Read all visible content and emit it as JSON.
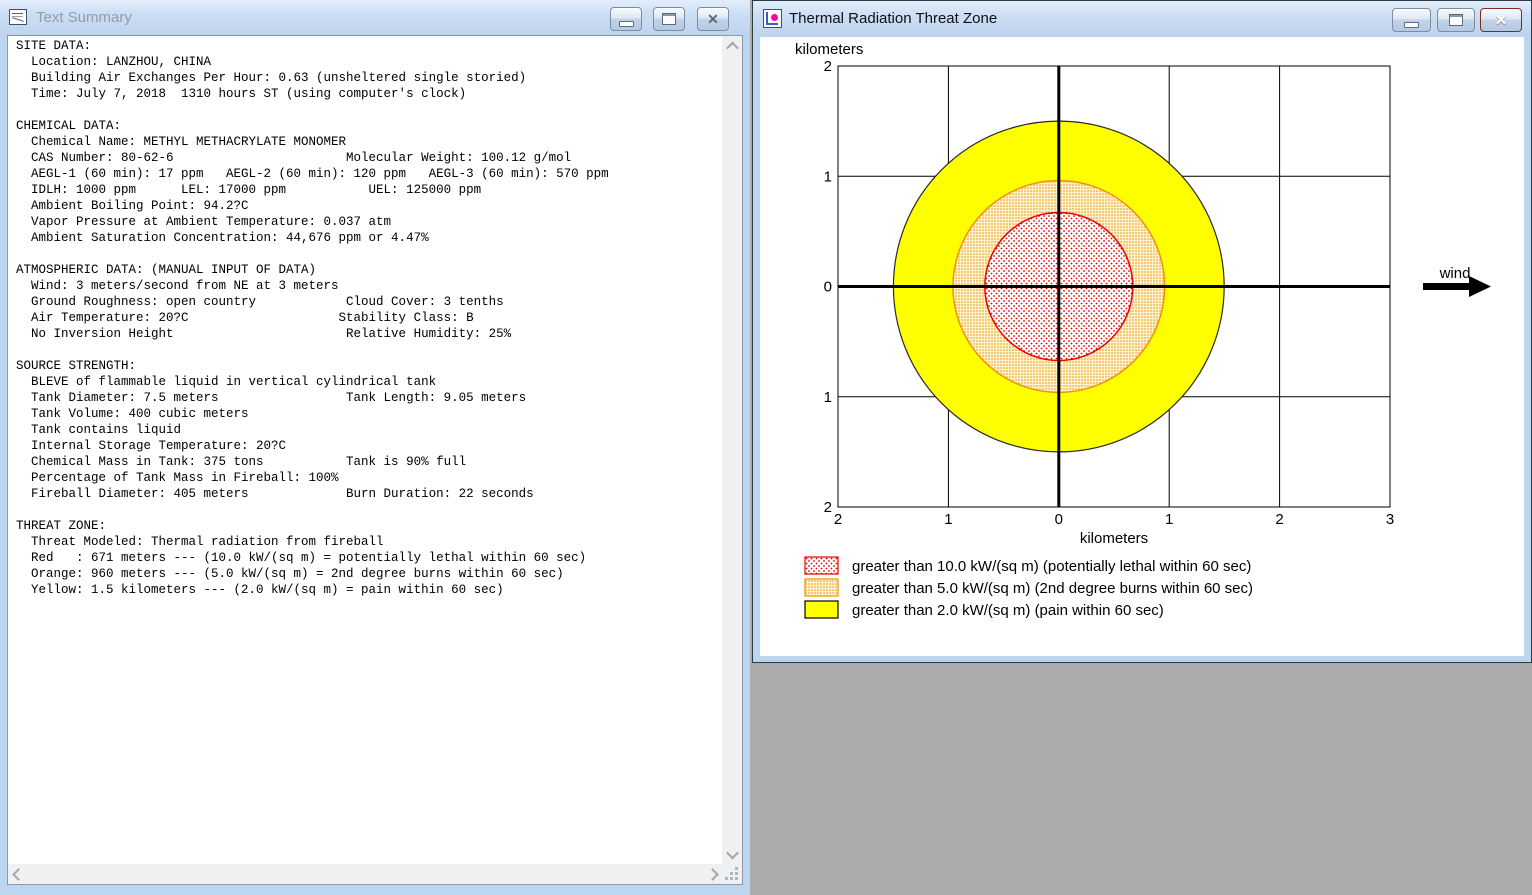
{
  "desktop": {
    "background_color": "#ababab"
  },
  "left_window": {
    "title": "Text Summary",
    "state": "inactive",
    "icon": "text-document-icon",
    "window_controls": [
      "minimize",
      "maximize",
      "close"
    ],
    "text_lines": [
      "SITE DATA:",
      "  Location: LANZHOU, CHINA",
      "  Building Air Exchanges Per Hour: 0.63 (unsheltered single storied)",
      "  Time: July 7, 2018  1310 hours ST (using computer's clock)",
      "",
      "CHEMICAL DATA:",
      "  Chemical Name: METHYL METHACRYLATE MONOMER",
      "  CAS Number: 80-62-6                       Molecular Weight: 100.12 g/mol",
      "  AEGL-1 (60 min): 17 ppm   AEGL-2 (60 min): 120 ppm   AEGL-3 (60 min): 570 ppm",
      "  IDLH: 1000 ppm      LEL: 17000 ppm           UEL: 125000 ppm",
      "  Ambient Boiling Point: 94.2?C",
      "  Vapor Pressure at Ambient Temperature: 0.037 atm",
      "  Ambient Saturation Concentration: 44,676 ppm or 4.47%",
      "",
      "ATMOSPHERIC DATA: (MANUAL INPUT OF DATA)",
      "  Wind: 3 meters/second from NE at 3 meters",
      "  Ground Roughness: open country            Cloud Cover: 3 tenths",
      "  Air Temperature: 20?C                    Stability Class: B",
      "  No Inversion Height                       Relative Humidity: 25%",
      "",
      "SOURCE STRENGTH:",
      "  BLEVE of flammable liquid in vertical cylindrical tank",
      "  Tank Diameter: 7.5 meters                 Tank Length: 9.05 meters",
      "  Tank Volume: 400 cubic meters",
      "  Tank contains liquid",
      "  Internal Storage Temperature: 20?C",
      "  Chemical Mass in Tank: 375 tons           Tank is 90% full",
      "  Percentage of Tank Mass in Fireball: 100%",
      "  Fireball Diameter: 405 meters             Burn Duration: 22 seconds",
      "",
      "THREAT ZONE:",
      "  Threat Modeled: Thermal radiation from fireball",
      "  Red   : 671 meters --- (10.0 kW/(sq m) = potentially lethal within 60 sec)",
      "  Orange: 960 meters --- (5.0 kW/(sq m) = 2nd degree burns within 60 sec)",
      "  Yellow: 1.5 kilometers --- (2.0 kW/(sq m) = pain within 60 sec)"
    ]
  },
  "right_window": {
    "title": "Thermal Radiation Threat Zone",
    "state": "active",
    "icon": "threat-zone-plot-icon",
    "window_controls": [
      "minimize",
      "maximize",
      "close"
    ]
  },
  "chart_data": {
    "type": "area",
    "title": "Thermal Radiation Threat Zone",
    "xlabel": "kilometers",
    "ylabel": "kilometers",
    "xlim": [
      -2,
      3
    ],
    "ylim": [
      -2,
      2
    ],
    "grid": true,
    "x_ticks": [
      -2,
      -1,
      0,
      1,
      2,
      3
    ],
    "x_tick_labels": [
      "2",
      "1",
      "0",
      "1",
      "2",
      "3"
    ],
    "y_ticks": [
      2,
      1,
      0,
      -1,
      -2
    ],
    "y_tick_labels": [
      "2",
      "1",
      "0",
      "1",
      "2"
    ],
    "center": [
      0,
      0
    ],
    "zones": [
      {
        "name": "red",
        "radius_km": 0.671,
        "color": "#e80000",
        "fill": "red-dots",
        "label": "greater than 10.0 kW/(sq m) (potentially lethal within 60 sec)"
      },
      {
        "name": "orange",
        "radius_km": 0.96,
        "color": "#ef9408",
        "fill": "orange-dots",
        "label": "greater than 5.0 kW/(sq m) (2nd degree burns within 60 sec)"
      },
      {
        "name": "yellow",
        "radius_km": 1.5,
        "color": "#2a2a2a",
        "fill": "solid",
        "fill_color": "#ffff00",
        "label": "greater than 2.0 kW/(sq m) (pain within 60 sec)"
      }
    ],
    "legend_position": "below",
    "wind": {
      "label": "wind",
      "direction": "right"
    }
  }
}
